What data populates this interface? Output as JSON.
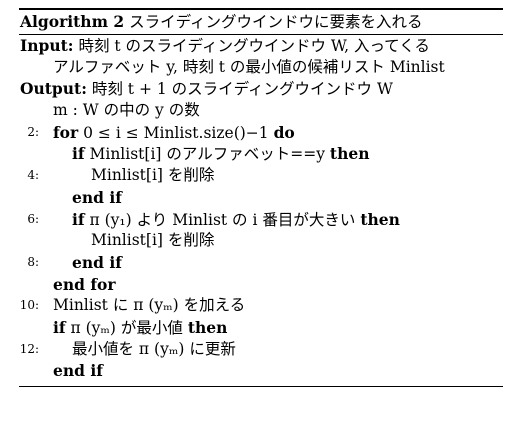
{
  "algorithm": {
    "caption_label": "Algorithm 2",
    "caption_text": "スライディングウインドウに要素を入れる",
    "input_label": "Input:",
    "input_line1": "時刻 t のスライディングウインドウ W, 入ってくる",
    "input_line2": "アルファベット y, 時刻 t の最小値の候補リスト Minlist",
    "output_label": "Output:",
    "output_line1": "時刻 t + 1 のスライディングウインドウ W",
    "output_line2": "m : W の中の y の数",
    "lines": [
      {
        "num": "",
        "kw": "",
        "text": ""
      },
      {
        "num": "2:",
        "kw": "for",
        "text": "0 ≤ i ≤ Minlist.size()−1",
        "kw2": "do"
      },
      {
        "num": "",
        "kw": "if",
        "text": "Minlist[i] のアルファベット==y",
        "kw2": "then"
      },
      {
        "num": "4:",
        "kw": "",
        "text": "Minlist[i] を削除"
      },
      {
        "num": "",
        "kw": "end if",
        "text": ""
      },
      {
        "num": "6:",
        "kw": "if",
        "text": "π (y₁) より Minlist の i 番目が大きい",
        "kw2": "then"
      },
      {
        "num": "",
        "kw": "",
        "text": "Minlist[i] を削除"
      },
      {
        "num": "8:",
        "kw": "end if",
        "text": ""
      },
      {
        "num": "",
        "kw": "end for",
        "text": ""
      },
      {
        "num": "10:",
        "kw": "",
        "text": "Minlist に π (yₘ) を加える"
      },
      {
        "num": "",
        "kw": "if",
        "text": "π (yₘ) が最小値",
        "kw2": "then"
      },
      {
        "num": "12:",
        "kw": "",
        "text": "最小値を π (yₘ) に更新"
      },
      {
        "num": "",
        "kw": "end if",
        "text": ""
      }
    ]
  }
}
